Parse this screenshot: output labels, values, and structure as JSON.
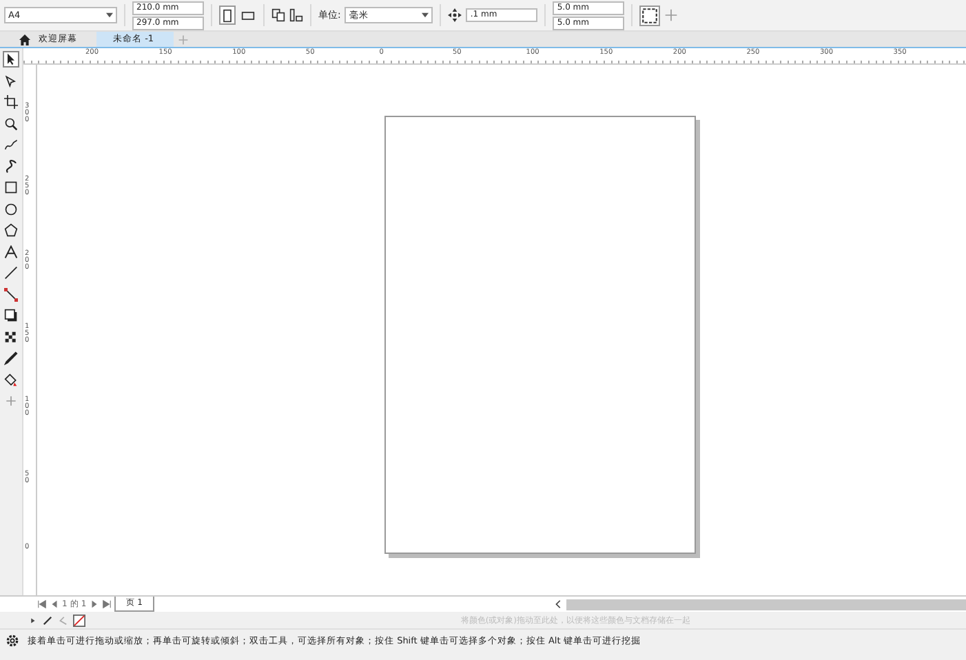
{
  "property_bar": {
    "page_size": "A4",
    "width": "210.0 mm",
    "height": "297.0 mm",
    "units_label": "单位:",
    "units": "毫米",
    "nudge": ".1 mm",
    "dup_x": "5.0 mm",
    "dup_y": "5.0 mm"
  },
  "orientation_buttons": [
    {
      "kind": "portrait",
      "selected": true
    },
    {
      "kind": "landscape",
      "selected": false
    }
  ],
  "tabs": [
    {
      "label": "欢迎屏幕",
      "selected": false,
      "kind": "home"
    },
    {
      "label": "未命名 -1",
      "selected": true,
      "kind": "doc"
    }
  ],
  "tools": [
    {
      "kind": "pick",
      "selected": true
    },
    {
      "kind": "shape",
      "selected": false
    },
    {
      "kind": "crop",
      "selected": false
    },
    {
      "kind": "zoom",
      "selected": false
    },
    {
      "kind": "freehand",
      "selected": false
    },
    {
      "kind": "artistic",
      "selected": false
    },
    {
      "kind": "rectangle",
      "selected": false
    },
    {
      "kind": "ellipse",
      "selected": false
    },
    {
      "kind": "polygon",
      "selected": false
    },
    {
      "kind": "text",
      "selected": false
    },
    {
      "kind": "dimension",
      "selected": false
    },
    {
      "kind": "connector",
      "selected": false
    },
    {
      "kind": "shadow",
      "selected": false
    },
    {
      "kind": "transparency",
      "selected": false
    },
    {
      "kind": "eyedropper",
      "selected": false
    },
    {
      "kind": "fill",
      "selected": false
    },
    {
      "kind": "add",
      "selected": false
    }
  ],
  "ruler_h": [
    "200",
    "150",
    "100",
    "50",
    "0",
    "50",
    "100",
    "150",
    "200",
    "250",
    "300",
    "350"
  ],
  "ruler_v": [
    "300",
    "250",
    "200",
    "150",
    "100",
    "50",
    "0"
  ],
  "page_nav": {
    "current": "1",
    "of": "的",
    "total": "1",
    "page_tab": "页 1"
  },
  "color_hint": "将颜色(或对象)拖动至此处，以便将这些颜色与文档存储在一起",
  "status": "接着单击可进行拖动或缩放；再单击可旋转或倾斜；双击工具，可选择所有对象；按住 Shift 键单击可选择多个对象；按住 Alt 键单击可进行挖掘"
}
